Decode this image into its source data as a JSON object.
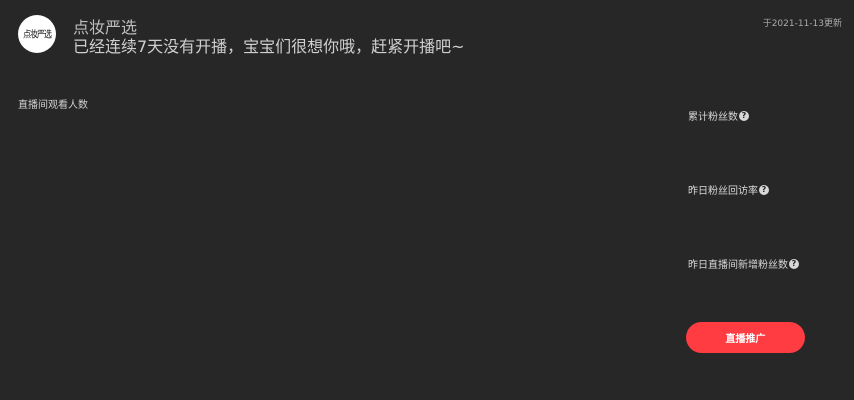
{
  "header": {
    "avatar_text": "点妆严选",
    "shop_name": "点妆严选",
    "notice": "已经连续7天没有开播，宝宝们很想你哦，赶紧开播吧~",
    "updated": "于2021-11-13更新"
  },
  "chart": {
    "title": "直播间观看人数"
  },
  "metrics": [
    {
      "label": "累计粉丝数",
      "icon": "help-icon"
    },
    {
      "label": "昨日粉丝回访率",
      "icon": "help-icon"
    },
    {
      "label": "昨日直播间新增粉丝数",
      "icon": "help-icon"
    }
  ],
  "actions": {
    "promote_label": "直播推广"
  },
  "colors": {
    "background": "#272727",
    "accent": "#fe3c42"
  }
}
